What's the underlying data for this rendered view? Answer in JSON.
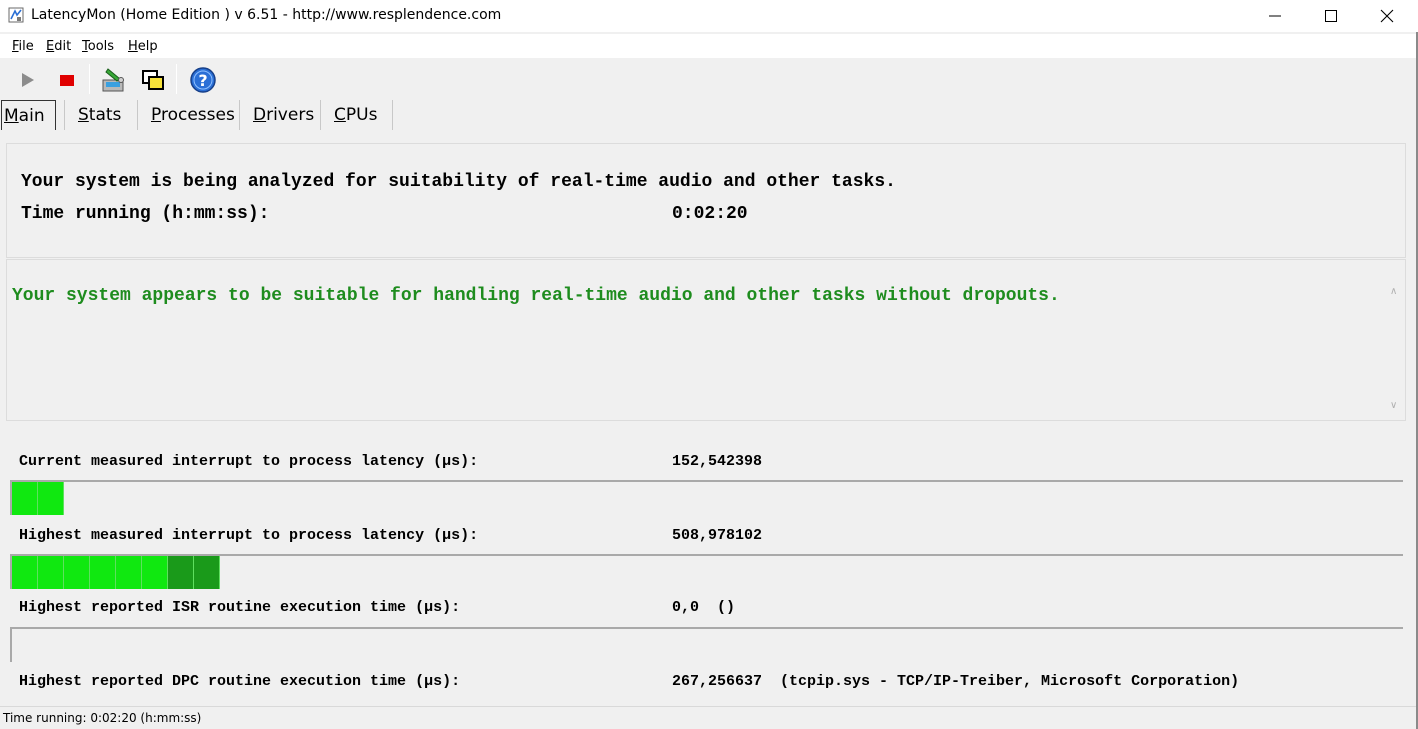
{
  "window": {
    "title": "LatencyMon  (Home Edition )  v 6.51 - http://www.resplendence.com",
    "icon": "latencymon-app-icon"
  },
  "menu": [
    {
      "prefix": "",
      "accel": "F",
      "rest": "ile"
    },
    {
      "prefix": "",
      "accel": "E",
      "rest": "dit"
    },
    {
      "prefix": "",
      "accel": "T",
      "rest": "ools"
    },
    {
      "prefix": "",
      "accel": "H",
      "rest": "elp"
    }
  ],
  "toolbar": {
    "icons": [
      "play-icon",
      "stop-icon",
      "analyze-icon",
      "windows-icon",
      "help-icon"
    ]
  },
  "tabs": [
    {
      "accel": "M",
      "rest": "ain",
      "active": true
    },
    {
      "accel": "S",
      "rest": "tats",
      "active": false
    },
    {
      "accel": "P",
      "rest": "rocesses",
      "active": false
    },
    {
      "accel": "D",
      "rest": "rivers",
      "active": false
    },
    {
      "accel": "C",
      "rest": "PUs",
      "active": false
    }
  ],
  "analysis": {
    "line1": "Your system is being analyzed for suitability of real-time audio and other tasks.",
    "time_label": "Time running (h:mm:ss):",
    "time_value": "0:02:20"
  },
  "verdict": {
    "text": "Your system appears to be suitable for handling real-time audio and other tasks without dropouts.",
    "color": "#1e8c1e"
  },
  "metrics": [
    {
      "label": "Current measured interrupt to process latency (µs):",
      "value": "152,542398",
      "bar_segments": 2
    },
    {
      "label": "Highest measured interrupt to process latency (µs):",
      "value": "508,978102",
      "bar_segments": 8
    },
    {
      "label": "Highest reported ISR routine execution time (µs):",
      "value": "0,0  ()",
      "bar_segments": 0
    },
    {
      "label": "Highest reported DPC routine execution time (µs):",
      "value": "267,256637  (tcpip.sys - TCP/IP-Treiber, Microsoft Corporation)",
      "bar_segments": null
    }
  ],
  "status": {
    "text": "Time running: 0:02:20  (h:mm:ss)"
  },
  "colors": {
    "bar_green": "#10e810",
    "bar_green_dark": "#1a9a1a",
    "stop_red": "#e00000",
    "help_blue": "#2a6fd6"
  }
}
